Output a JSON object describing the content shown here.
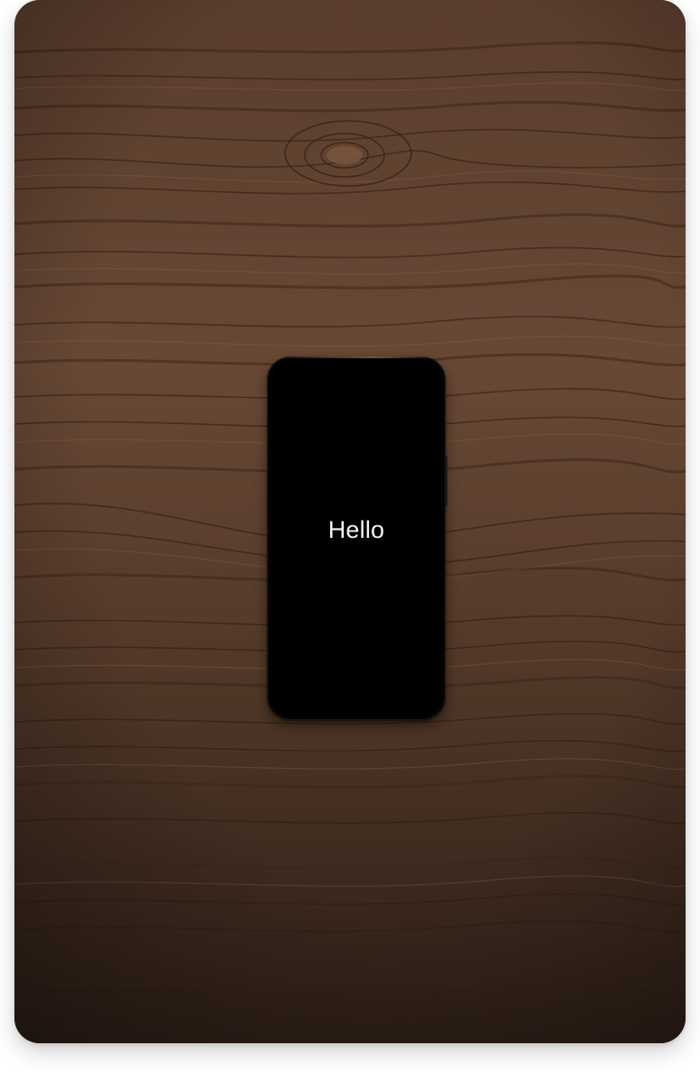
{
  "phone": {
    "screen_text": "Hello"
  },
  "colors": {
    "wood_base": "#4a3124",
    "phone_body": "#030303",
    "screen_text": "#f4f4f4"
  }
}
